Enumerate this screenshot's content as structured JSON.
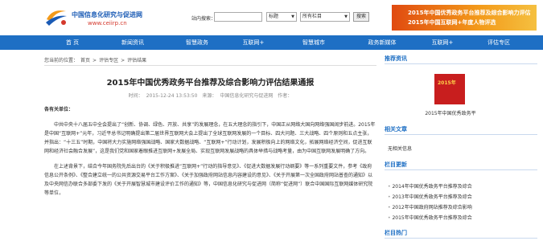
{
  "header": {
    "logo_cn": "中国信息化研究与促进网",
    "logo_url": "www.ceiirp.cn",
    "search_label": "站内搜索：",
    "select1": "标题",
    "select2": "所有栏目",
    "search_button": "搜索",
    "banner_line1": "2015年中国优秀政务平台推荐及综合影响力评估",
    "banner_line2": "2015年中国互联网+年度人物评选"
  },
  "nav": [
    "首 页",
    "新闻资讯",
    "智慧政务",
    "互联网+",
    "智慧城市",
    "政务新媒体",
    "互联网+",
    "评估专区"
  ],
  "breadcrumb": [
    "您当前的位置：",
    "首页",
    ">",
    "评估专区",
    ">",
    "评估结果"
  ],
  "article": {
    "title": "2015年中国优秀政务平台推荐及综合影响力评估结果通报",
    "time_label": "时间：",
    "time": "2015-12-24 13:53:50",
    "source_label": "来源：",
    "source": "中国信息化研究与促进网",
    "author_label": "作者：",
    "salutation": "各有关单位：",
    "para1": "中共中央十八届五中全会提出了“创新、协调、绿色、开放、共享”的发展理念，在五大理念的指引下，中国正从网络大国向网络强国阔步前进。2015年是中国“互联网+”元年，习近平总书记明确提出第二届世界互联网大会上提出了全球互联网发展的一个目标、四大问题、三大战略、四个原则和五点主张，并指出：“十三五”时期，中国将大力实施网络强国战略、国家大数据战略、“互联网+”行动计划，发展积极向上的网络文化，拓展网络经济空间，促进互联网和经济社会融合发展”，这是我们党和国家着眼推进互联网+发展全局、实现互联网发展战略的具体举措与战略考量，由为中国互联网发展明确了方向。",
    "para2": "在上述背景下，结合今年国务院先后出台的《关于积极推进“互联网+”行动的指导意见》、《促进大数据发展行动纲要》等一系列重要文件，参考《政府信息公开条例》、《整合建立统一的公共资源交易平台工作方案》、《关于加强政府网站信息内容建设的意见》、《关于开展第一次全国政府网站普查的通知》以及中央网信办联合多部委下发的《关于开展智慧城市建设评价工作的通知》等，中国信息化研究与促进网（简称“促进网”）联合中国国际互联网媒体研究院等单位，"
  },
  "sidebar": {
    "recommend_title": "推荐资讯",
    "thumb_text": "2015年",
    "thumb_caption": "2015年中国优秀政务平",
    "related_title": "相关文章",
    "related_item": "无相关信息",
    "column_title": "栏目更新",
    "column_items": [
      "2014年中国优秀政务平台推荐及综合",
      "2013年中国优秀政务平台推荐及综合",
      "2012年中国政府网站推荐及综合影响",
      "2015年中国优秀政务平台推荐及综合"
    ],
    "hot_title": "栏目热门"
  },
  "colors": {
    "nav_bg": "#1e6fc4",
    "banner": "#e04a10",
    "accent_red": "#d4382c"
  }
}
